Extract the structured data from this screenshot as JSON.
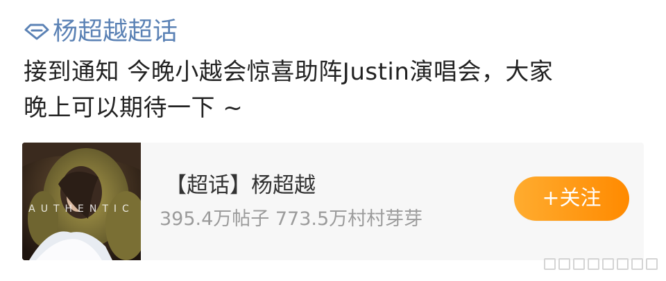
{
  "topic_link": {
    "icon": "diamond-icon",
    "label": "杨超越超话",
    "color": "#5b82b5"
  },
  "post": {
    "text_line1": "接到通知 今晚小越会惊喜助阵Justin演唱会，大家",
    "text_line2": "晚上可以期待一下 ~"
  },
  "card": {
    "cover_text": "AUTHENTIC",
    "title": "【超话】杨超越",
    "stats": "395.4万帖子 773.5万村村芽芽",
    "follow_button": "+关注",
    "follow_color": "#ff9a16"
  },
  "watermark": {
    "label": "",
    "icon": "watermark-icon"
  }
}
